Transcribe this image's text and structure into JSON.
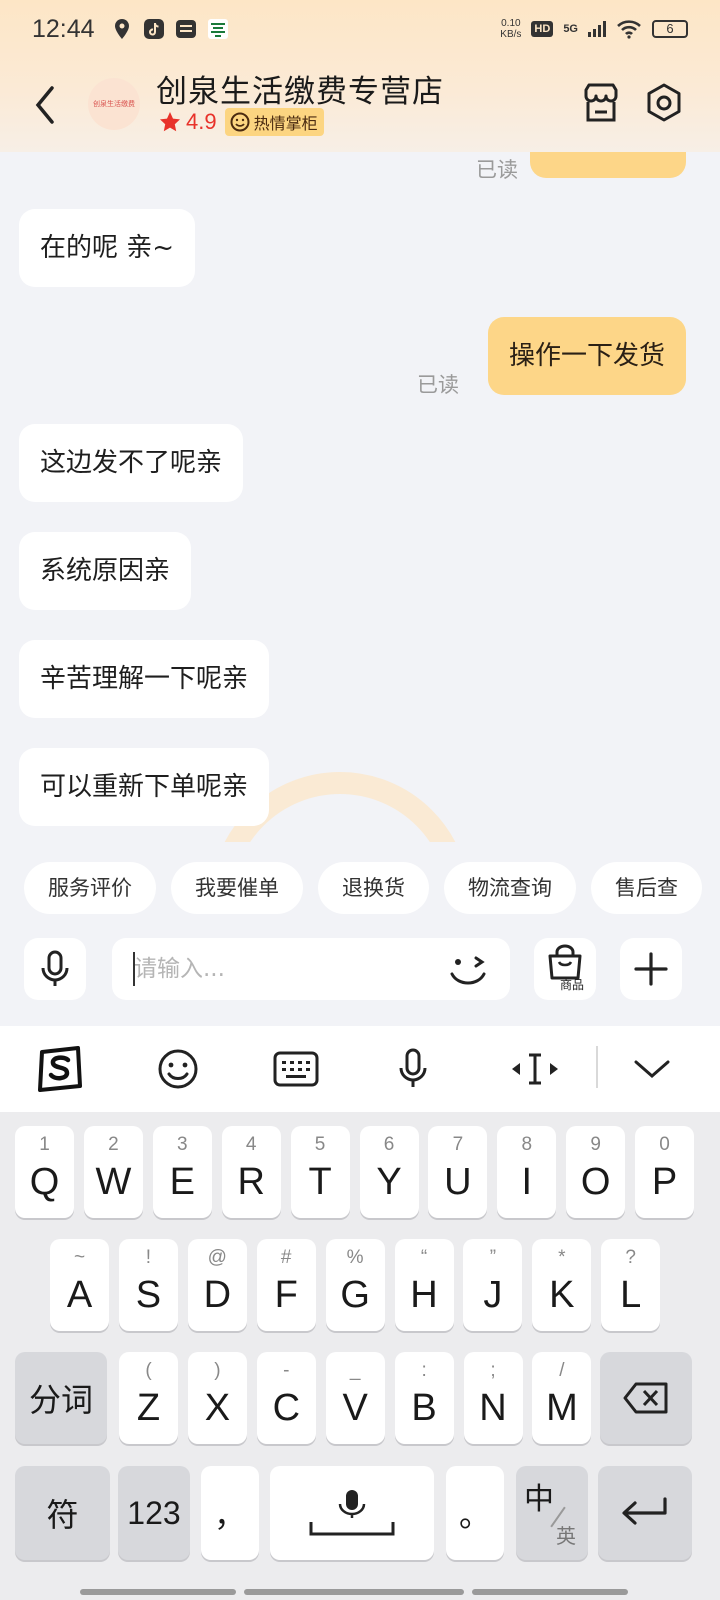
{
  "status_bar": {
    "time": "12:44",
    "net_speed_value": "0.10",
    "net_speed_unit": "KB/s",
    "hd": "HD",
    "signal": "5G",
    "battery": "6"
  },
  "header": {
    "shop_name": "创泉生活缴费专营店",
    "rating": "4.9",
    "badge": "热情掌柜",
    "avatar_text": "创泉生活缴费"
  },
  "chat": {
    "messages": [
      {
        "side": "out",
        "text": "",
        "read": "已读"
      },
      {
        "side": "in",
        "text": "在的呢 亲~"
      },
      {
        "side": "out",
        "text": "操作一下发货",
        "read": "已读"
      },
      {
        "side": "in",
        "text": "这边发不了呢亲"
      },
      {
        "side": "in",
        "text": "系统原因亲"
      },
      {
        "side": "in",
        "text": "辛苦理解一下呢亲"
      },
      {
        "side": "in",
        "text": "可以重新下单呢亲"
      }
    ]
  },
  "quick_replies": [
    "服务评价",
    "我要催单",
    "退换货",
    "物流查询",
    "售后查"
  ],
  "input": {
    "placeholder": "请输入...",
    "goods_label": "商品"
  },
  "keyboard": {
    "row1": [
      {
        "main": "Q",
        "sub": "1"
      },
      {
        "main": "W",
        "sub": "2"
      },
      {
        "main": "E",
        "sub": "3"
      },
      {
        "main": "R",
        "sub": "4"
      },
      {
        "main": "T",
        "sub": "5"
      },
      {
        "main": "Y",
        "sub": "6"
      },
      {
        "main": "U",
        "sub": "7"
      },
      {
        "main": "I",
        "sub": "8"
      },
      {
        "main": "O",
        "sub": "9"
      },
      {
        "main": "P",
        "sub": "0"
      }
    ],
    "row2": [
      {
        "main": "A",
        "sub": "~"
      },
      {
        "main": "S",
        "sub": "!"
      },
      {
        "main": "D",
        "sub": "@"
      },
      {
        "main": "F",
        "sub": "#"
      },
      {
        "main": "G",
        "sub": "%"
      },
      {
        "main": "H",
        "sub": "“"
      },
      {
        "main": "J",
        "sub": "”"
      },
      {
        "main": "K",
        "sub": "*"
      },
      {
        "main": "L",
        "sub": "?"
      }
    ],
    "row3": [
      {
        "main": "Z",
        "sub": "("
      },
      {
        "main": "X",
        "sub": ")"
      },
      {
        "main": "C",
        "sub": "-"
      },
      {
        "main": "V",
        "sub": "_"
      },
      {
        "main": "B",
        "sub": ":"
      },
      {
        "main": "N",
        "sub": ";"
      },
      {
        "main": "M",
        "sub": "/"
      }
    ],
    "fenci": "分词",
    "symbol": "符",
    "numbers": "123",
    "comma": "，",
    "period": "。",
    "lang_main": "中",
    "lang_sub": "英"
  },
  "colors": {
    "header_bg": "#fde6c6",
    "outgoing_bubble": "#fdd688",
    "incoming_bubble": "#ffffff",
    "rating_red": "#e8322a",
    "badge_bg": "#fcd581"
  }
}
